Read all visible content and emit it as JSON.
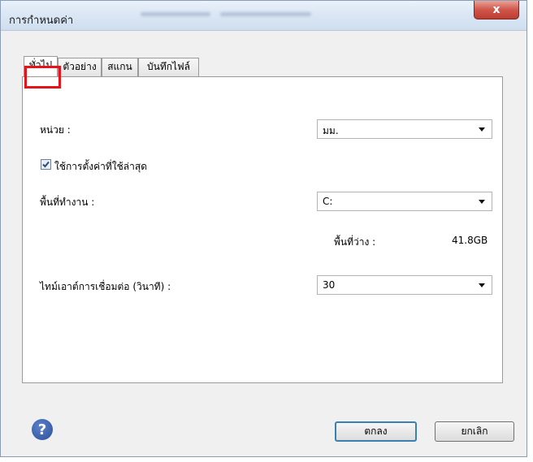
{
  "window": {
    "title": "การกำหนดค่า",
    "close_label": "x"
  },
  "tabs": [
    {
      "label": "ทั่วไป",
      "active": true
    },
    {
      "label": "ตัวอย่าง",
      "active": false
    },
    {
      "label": "สแกน",
      "active": false
    },
    {
      "label": "บันทึกไฟล์",
      "active": false
    }
  ],
  "general": {
    "unit_label": "หน่วย :",
    "unit_value": "มม.",
    "use_last_settings_label": "ใช้การตั้งค่าที่ใช้ล่าสุด",
    "use_last_settings_checked": true,
    "workspace_label": "พื้นที่ทำงาน :",
    "workspace_value": "C:",
    "free_space_label": "พื้นที่ว่าง :",
    "free_space_value": "41.8GB",
    "timeout_label": "ไทม์เอาต์การเชื่อมต่อ (วินาที) :",
    "timeout_value": "30"
  },
  "buttons": {
    "ok_label": "ตกลง",
    "cancel_label": "ยกเลิก"
  },
  "icons": {
    "help": "help-icon",
    "close": "close-icon",
    "check": "checkmark-icon",
    "dropdown": "chevron-down-icon"
  },
  "colors": {
    "active_tab_highlight": "#e5141b",
    "close_button": "#c94a3f",
    "help_icon": "#2c4f9a",
    "default_button_border": "#3c7fb1"
  }
}
